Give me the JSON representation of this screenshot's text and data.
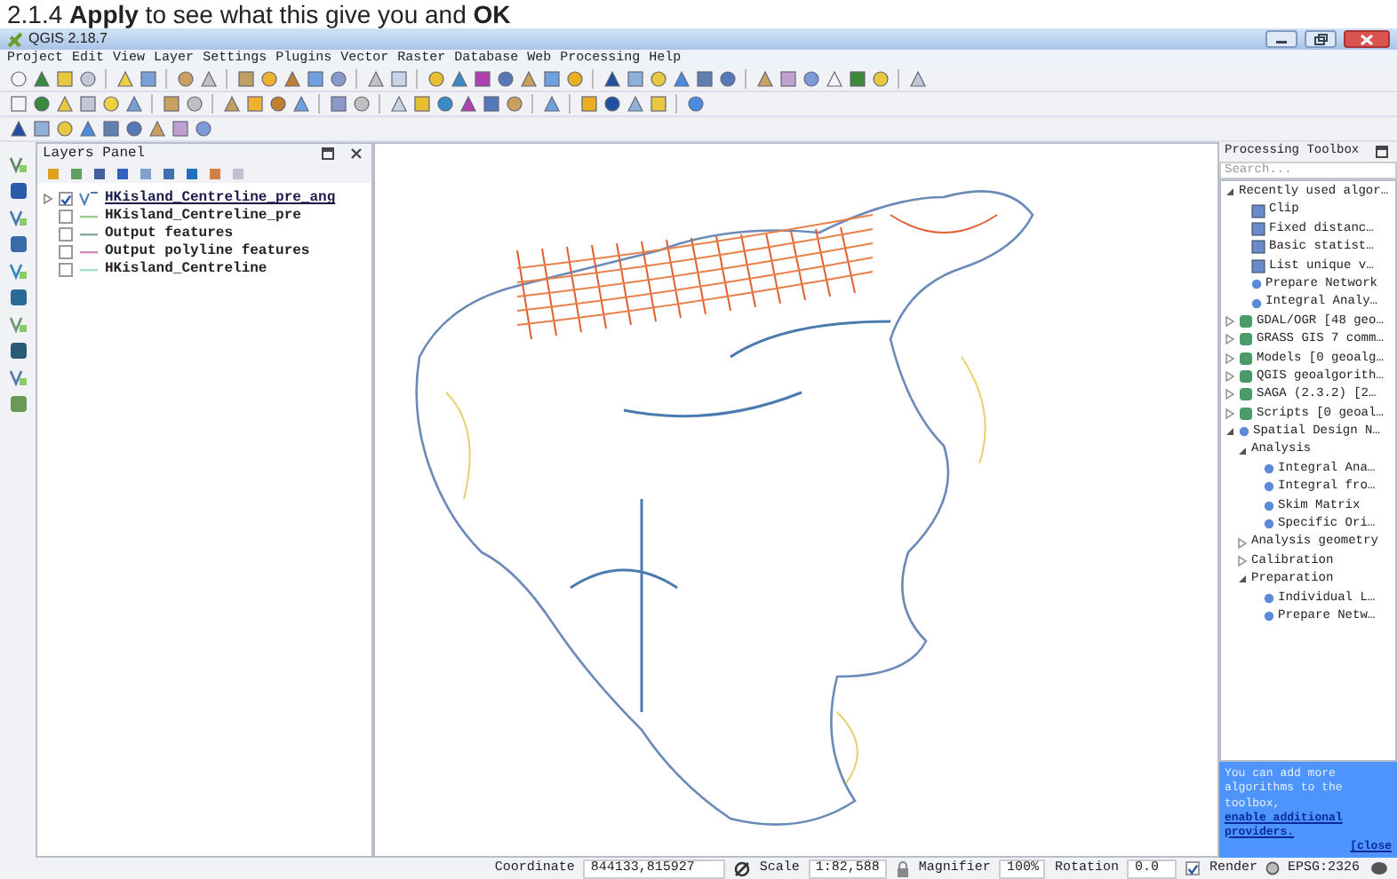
{
  "slide_caption": "2.1.4 **Apply** to see what this give you and **OK**",
  "window": {
    "title": "QGIS 2.18.7"
  },
  "menu": [
    "Project",
    "Edit",
    "View",
    "Layer",
    "Settings",
    "Plugins",
    "Vector",
    "Raster",
    "Database",
    "Web",
    "Processing",
    "Help"
  ],
  "layers_panel": {
    "title": "Layers Panel",
    "layers": [
      {
        "name": "HKisland_Centreline_pre_ang",
        "kind": "vector",
        "checked": true,
        "selected": true,
        "expanded": false
      },
      {
        "name": "HKisland_Centreline_pre",
        "kind": "line",
        "checked": false,
        "selected": false,
        "color": "#9ccf8c"
      },
      {
        "name": "Output features",
        "kind": "line",
        "checked": false,
        "selected": false,
        "color": "#8aa89a"
      },
      {
        "name": "Output polyline features",
        "kind": "line",
        "checked": false,
        "selected": false,
        "color": "#d98ab4"
      },
      {
        "name": "HKisland_Centreline",
        "kind": "line",
        "checked": false,
        "selected": false,
        "color": "#a6e0c4"
      }
    ]
  },
  "processing_toolbox": {
    "title": "Processing Toolbox",
    "search": {
      "placeholder": "Search..."
    },
    "tree": [
      {
        "label": "Recently used algor…",
        "kind": "group",
        "expanded": true,
        "children": [
          {
            "label": "Clip",
            "kind": "tool"
          },
          {
            "label": "Fixed distanc…",
            "kind": "tool"
          },
          {
            "label": "Basic statist…",
            "kind": "tool"
          },
          {
            "label": "List unique v…",
            "kind": "tool"
          },
          {
            "label": "Prepare Network",
            "kind": "algorithm"
          },
          {
            "label": "Integral Analy…",
            "kind": "algorithm"
          }
        ]
      },
      {
        "label": "GDAL/OGR [48 geo…",
        "kind": "provider",
        "expanded": false
      },
      {
        "label": "GRASS GIS 7 comm…",
        "kind": "provider",
        "expanded": false
      },
      {
        "label": "Models [0 geoalg…",
        "kind": "provider",
        "expanded": false
      },
      {
        "label": "QGIS geoalgorith…",
        "kind": "provider",
        "expanded": false
      },
      {
        "label": "SAGA (2.3.2) [2…",
        "kind": "provider",
        "expanded": false
      },
      {
        "label": "Scripts [0 geoal…",
        "kind": "provider",
        "expanded": false
      },
      {
        "label": "Spatial Design N…",
        "kind": "algorithm-group",
        "expanded": true,
        "children": [
          {
            "label": "Analysis",
            "kind": "group",
            "expanded": true,
            "children": [
              {
                "label": "Integral Ana…",
                "kind": "algorithm"
              },
              {
                "label": "Integral fro…",
                "kind": "algorithm"
              },
              {
                "label": "Skim Matrix",
                "kind": "algorithm"
              },
              {
                "label": "Specific Ori…",
                "kind": "algorithm"
              }
            ]
          },
          {
            "label": "Analysis geometry",
            "kind": "group",
            "expanded": false
          },
          {
            "label": "Calibration",
            "kind": "group",
            "expanded": false
          },
          {
            "label": "Preparation",
            "kind": "group",
            "expanded": true,
            "children": [
              {
                "label": "Individual L…",
                "kind": "algorithm"
              },
              {
                "label": "Prepare Netw…",
                "kind": "algorithm"
              }
            ]
          }
        ]
      }
    ],
    "notice": {
      "text": "You can add more algorithms to the toolbox,",
      "link": "enable additional providers.",
      "close": "[close"
    }
  },
  "status_bar": {
    "coordinate_label": "Coordinate",
    "coordinate": "844133,815927",
    "scale_label": "Scale",
    "scale": "1:82,588",
    "magnifier_label": "Magnifier",
    "magnifier": "100%",
    "rotation_label": "Rotation",
    "rotation": "0.0",
    "render": {
      "label": "Render",
      "checked": true
    },
    "crs": "EPSG:2326"
  }
}
